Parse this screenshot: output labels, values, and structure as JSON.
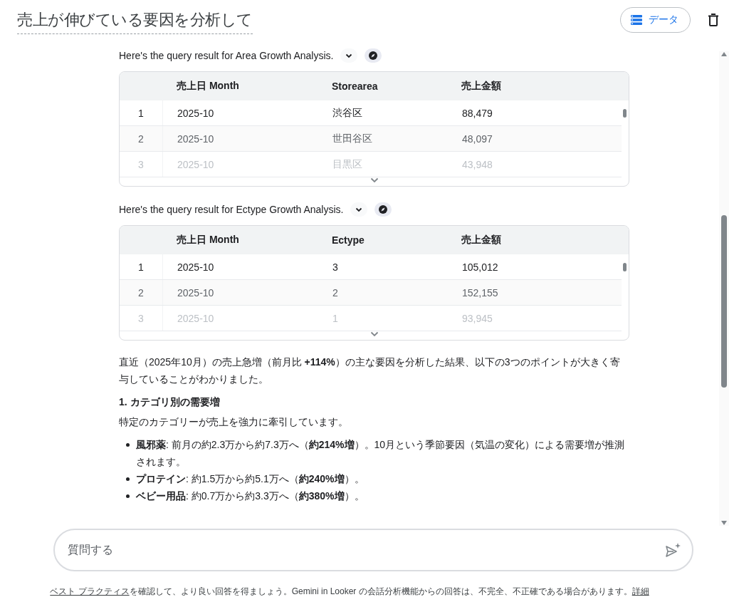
{
  "header": {
    "title": "売上が伸びている要因を分析して",
    "data_button": "データ"
  },
  "results": [
    {
      "caption": "Here's the query result for Area Growth Analysis.",
      "columns": [
        "売上日 Month",
        "Storearea",
        "売上金額"
      ],
      "rows": [
        {
          "index": "1",
          "cells": [
            "2025-10",
            "渋谷区",
            "88,479"
          ]
        },
        {
          "index": "2",
          "cells": [
            "2025-10",
            "世田谷区",
            "48,097"
          ]
        },
        {
          "index": "3",
          "cells": [
            "2025-10",
            "目黒区",
            "43,948"
          ]
        }
      ]
    },
    {
      "caption": "Here's the query result for Ectype Growth Analysis.",
      "columns": [
        "売上日 Month",
        "Ectype",
        "売上金額"
      ],
      "rows": [
        {
          "index": "1",
          "cells": [
            "2025-10",
            "3",
            "105,012"
          ]
        },
        {
          "index": "2",
          "cells": [
            "2025-10",
            "2",
            "152,155"
          ]
        },
        {
          "index": "3",
          "cells": [
            "2025-10",
            "1",
            "93,945"
          ]
        }
      ]
    }
  ],
  "answer": {
    "intro": "直近（2025年10月）の売上急増（前月比 **+114%**）の主な要因を分析した結果、以下の3つのポイントが大きく寄与していることがわかりました。",
    "heading": "1. カテゴリ別の需要増",
    "lead": "特定のカテゴリーが売上を強力に牽引しています。",
    "bullets": [
      "**風邪薬**: 前月の約2.3万から約7.3万へ（**約214%増**）。10月という季節要因（気温の変化）による需要増が推測されます。",
      "**プロテイン**: 約1.5万から約5.1万へ（**約240%増**）。",
      "**ベビー用品**: 約0.7万から約3.3万へ（**約380%増**）。"
    ]
  },
  "input": {
    "placeholder": "質問する"
  },
  "footer": {
    "link": "ベスト プラクティス",
    "text": "を確認して、より良い回答を得ましょう。Gemini in Looker の会話分析機能からの回答は、不完全、不正確である場合があります。",
    "more_link": "詳細"
  }
}
